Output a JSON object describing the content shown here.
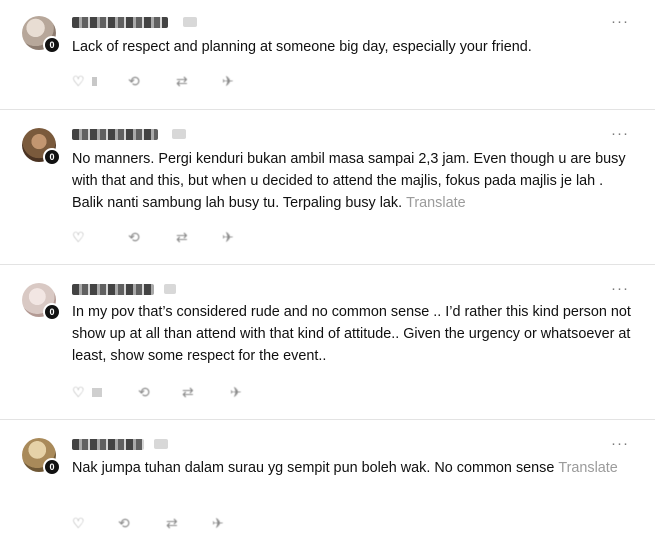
{
  "more_glyph": "···",
  "badge_glyph": "0",
  "action_icons": {
    "like": "♡",
    "reply": "⟲",
    "repost": "⇄",
    "share": "✈"
  },
  "posts": [
    {
      "text": "Lack of respect and planning at someone big day, especially your friend.",
      "translate": "",
      "avatar_color": "#b7a79a"
    },
    {
      "text": "No manners. Pergi kenduri bukan ambil masa sampai 2,3 jam. Even though u are busy with that and this, but when u decided to attend the majlis, fokus pada majlis je lah . Balik nanti sambung lah busy tu. Terpaling busy lak.",
      "translate": "Translate",
      "avatar_color": "#7a5a3c"
    },
    {
      "text": "In my pov that’s considered rude and no common sense .. I’d rather this kind person not show up at all than attend with that kind of attitude.. Given the urgency or whatsoever at least, show some respect for the event..",
      "translate": "",
      "avatar_color": "#d9c9c4"
    },
    {
      "text": "Nak jumpa tuhan dalam surau yg sempit pun boleh wak. No common sense",
      "translate": "Translate",
      "avatar_color": "#a98a5a"
    }
  ]
}
